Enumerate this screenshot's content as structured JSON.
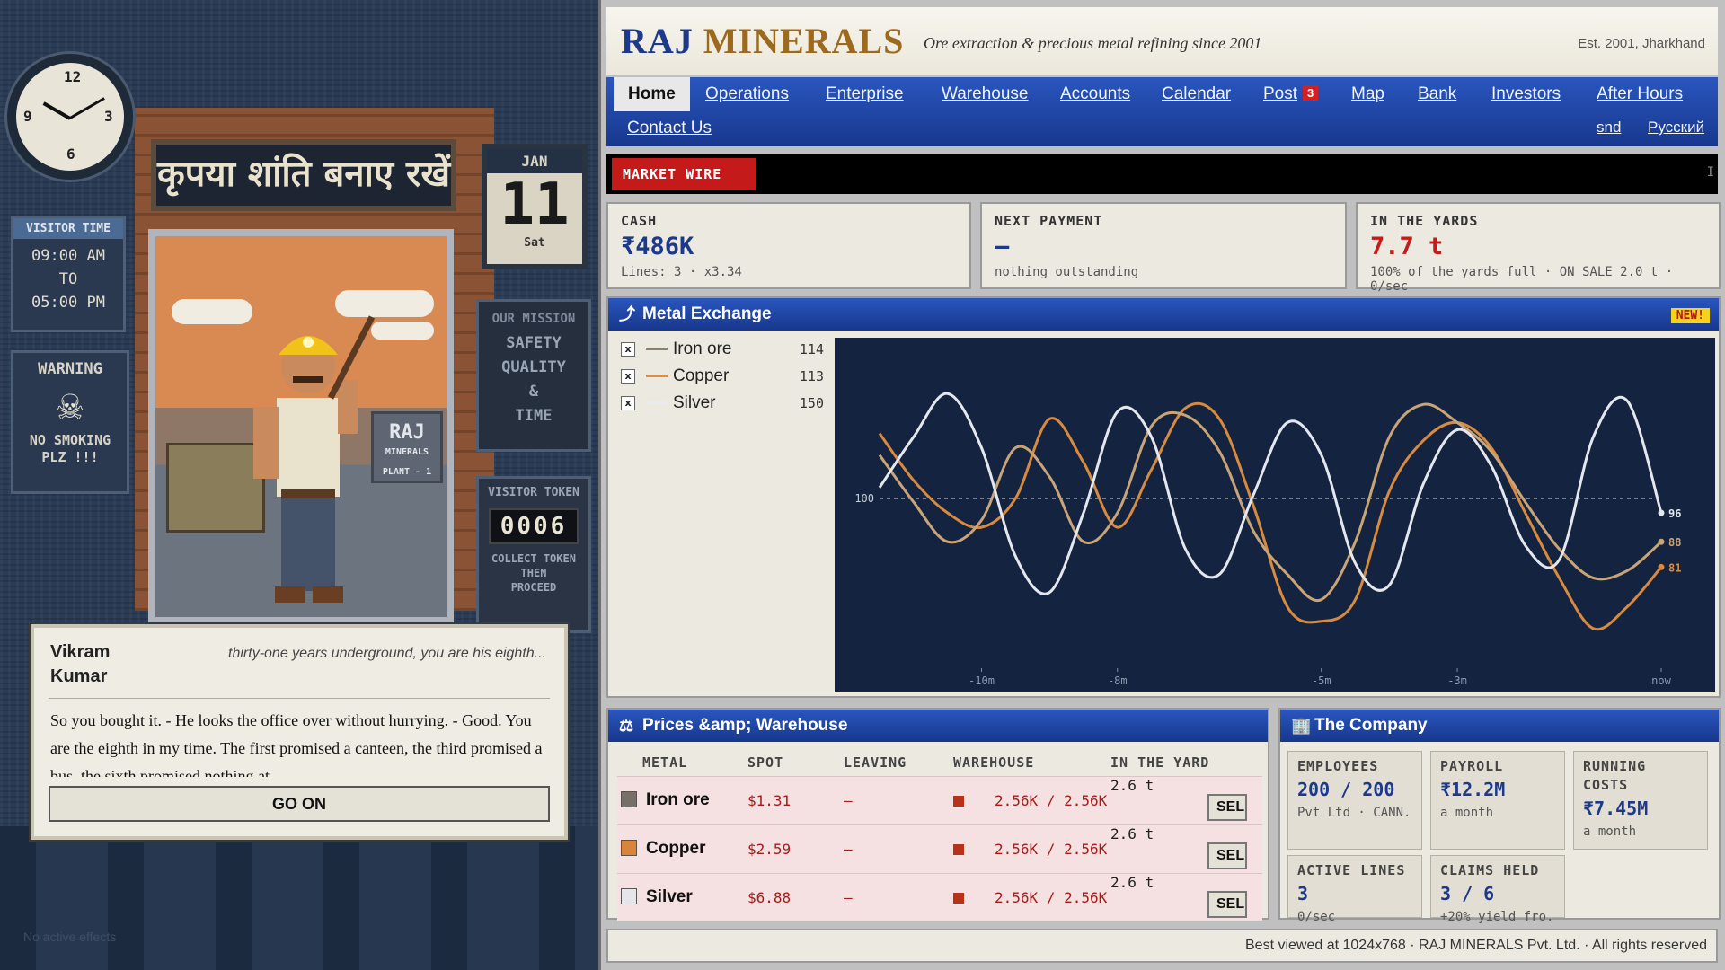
{
  "scene": {
    "clock_numbers": [
      "12",
      "3",
      "6",
      "9"
    ],
    "visitor_time": {
      "title": "VISITOR TIME",
      "lines": [
        "09:00 AM",
        "TO",
        "05:00 PM"
      ]
    },
    "warning": {
      "title": "WARNING",
      "line1": "NO SMOKING",
      "line2": "PLZ !!!"
    },
    "hindi_sign": "कृपया शांति बनाए रखें",
    "calendar": {
      "month": "JAN",
      "day": "11",
      "weekday": "Sat"
    },
    "mission": {
      "title": "OUR MISSION",
      "lines": [
        "SAFETY",
        "QUALITY",
        "&",
        "TIME"
      ]
    },
    "token": {
      "title": "VISITOR TOKEN",
      "number": "0006",
      "note1": "COLLECT TOKEN",
      "note2": "THEN",
      "note3": "PROCEED"
    },
    "plant_sign": {
      "line1": "RAJ",
      "line2": "MINERALS",
      "line3": "PLANT - 1"
    },
    "dialogue": {
      "speaker": "Vikram Kumar",
      "subtitle": "thirty-one years underground, you are his eighth...",
      "text": "So you bought it. - He looks the office over without hurrying. - Good. You are the eighth in my time. The first promised a canteen, the third promised a bus, the sixth promised nothing at",
      "button": "GO ON"
    },
    "effects": "No active effects"
  },
  "site": {
    "brand_main": "RAJ",
    "brand_accent": "MINERALS",
    "tagline": "Ore extraction & precious metal refining since 2001",
    "established": "Est. 2001, Jharkhand",
    "nav": {
      "items": [
        "Home",
        "Operations",
        "Enterprise",
        "Warehouse",
        "Accounts",
        "Calendar",
        "Post",
        "Map",
        "Bank",
        "Investors",
        "After Hours",
        "Contact Us"
      ],
      "post_badge": "3",
      "lang_1": "snd",
      "lang_2": "Русский"
    },
    "ticker": {
      "label": "MARKET WIRE",
      "trailing": "I"
    },
    "stats": {
      "cash": {
        "label": "CASH",
        "value": "₹486K",
        "sub": "Lines: 3 · x3.34"
      },
      "payment": {
        "label": "NEXT PAYMENT",
        "value": "—",
        "sub": "nothing outstanding"
      },
      "yards": {
        "label": "IN THE YARDS",
        "value": "7.7 t",
        "sub": "100% of the yards full · ON SALE 2.0 t · 0/sec"
      }
    },
    "exchange": {
      "title": "Metal Exchange",
      "new_badge": "NEW!",
      "legend": [
        {
          "name": "Iron ore",
          "value": "114",
          "color": "#8a8070",
          "checked": "x"
        },
        {
          "name": "Copper",
          "value": "113",
          "color": "#e88a3e",
          "checked": "x"
        },
        {
          "name": "Silver",
          "value": "150",
          "color": "#e8ecf2",
          "checked": "x"
        }
      ]
    },
    "prices": {
      "title": "Prices &amp; Warehouse",
      "headers": [
        "METAL",
        "SPOT",
        "LEAVING",
        "WAREHOUSE",
        "IN THE YARD"
      ],
      "rows": [
        {
          "metal": "Iron ore",
          "swatch": "#777068",
          "spot": "$1.31",
          "leaving": "—",
          "warehouse": "2.56K / 2.56K",
          "yard": "2.6 t",
          "action": "SELL"
        },
        {
          "metal": "Copper",
          "swatch": "#d8843a",
          "spot": "$2.59",
          "leaving": "—",
          "warehouse": "2.56K / 2.56K",
          "yard": "2.6 t",
          "action": "SELL"
        },
        {
          "metal": "Silver",
          "swatch": "#e4e6ea",
          "spot": "$6.88",
          "leaving": "—",
          "warehouse": "2.56K / 2.56K",
          "yard": "2.6 t",
          "action": "SELL"
        }
      ]
    },
    "company": {
      "title": "The Company",
      "cards": [
        {
          "label": "EMPLOYEES",
          "value": "200 / 200",
          "sub": "Pvt Ltd · CANN..."
        },
        {
          "label": "PAYROLL",
          "value": "₹12.2M",
          "sub": "a month"
        },
        {
          "label": "RUNNING COSTS",
          "value": "₹7.45M",
          "sub": "a month"
        },
        {
          "label": "ACTIVE LINES",
          "value": "3",
          "sub": "0/sec"
        },
        {
          "label": "CLAIMS HELD",
          "value": "3 / 6",
          "sub": "+20% yield fro..."
        }
      ]
    },
    "footer": "Best viewed at 1024x768 · RAJ MINERALS Pvt. Ltd. · All rights reserved"
  },
  "chart_data": {
    "type": "line",
    "x": [
      -11.5,
      -11,
      -10.5,
      -10,
      -9.5,
      -9,
      -8.5,
      -8,
      -7.5,
      -7,
      -6.5,
      -6,
      -5.5,
      -5,
      -4.5,
      -4,
      -3.5,
      -3,
      -2.5,
      -2,
      -1.5,
      -1,
      -0.5,
      0
    ],
    "x_ticks": [
      "-10m",
      "-8m",
      "-5m",
      "-3m",
      "now"
    ],
    "x_tick_values": [
      -10,
      -8,
      -5,
      -3,
      0
    ],
    "reference_line": 100,
    "reference_label": "100",
    "ylim": [
      55,
      140
    ],
    "series": [
      {
        "name": "Iron ore",
        "color": "#d88a3e",
        "values": [
          118,
          105,
          96,
          92,
          100,
          122,
          110,
          92,
          108,
          125,
          122,
          98,
          70,
          66,
          72,
          102,
          116,
          121,
          114,
          96,
          78,
          64,
          70,
          81
        ]
      },
      {
        "name": "Copper",
        "color": "#c8a477",
        "values": [
          112,
          99,
          88,
          94,
          114,
          106,
          88,
          96,
          120,
          123,
          113,
          91,
          79,
          72,
          88,
          117,
          126,
          121,
          113,
          99,
          86,
          78,
          80,
          88
        ]
      },
      {
        "name": "Silver",
        "color": "#e4e8ee",
        "values": [
          103,
          117,
          129,
          114,
          84,
          74,
          96,
          124,
          117,
          86,
          79,
          101,
          121,
          112,
          82,
          76,
          104,
          119,
          109,
          87,
          83,
          117,
          127,
          96
        ]
      }
    ],
    "end_labels": [
      "96",
      "88",
      "81"
    ]
  }
}
